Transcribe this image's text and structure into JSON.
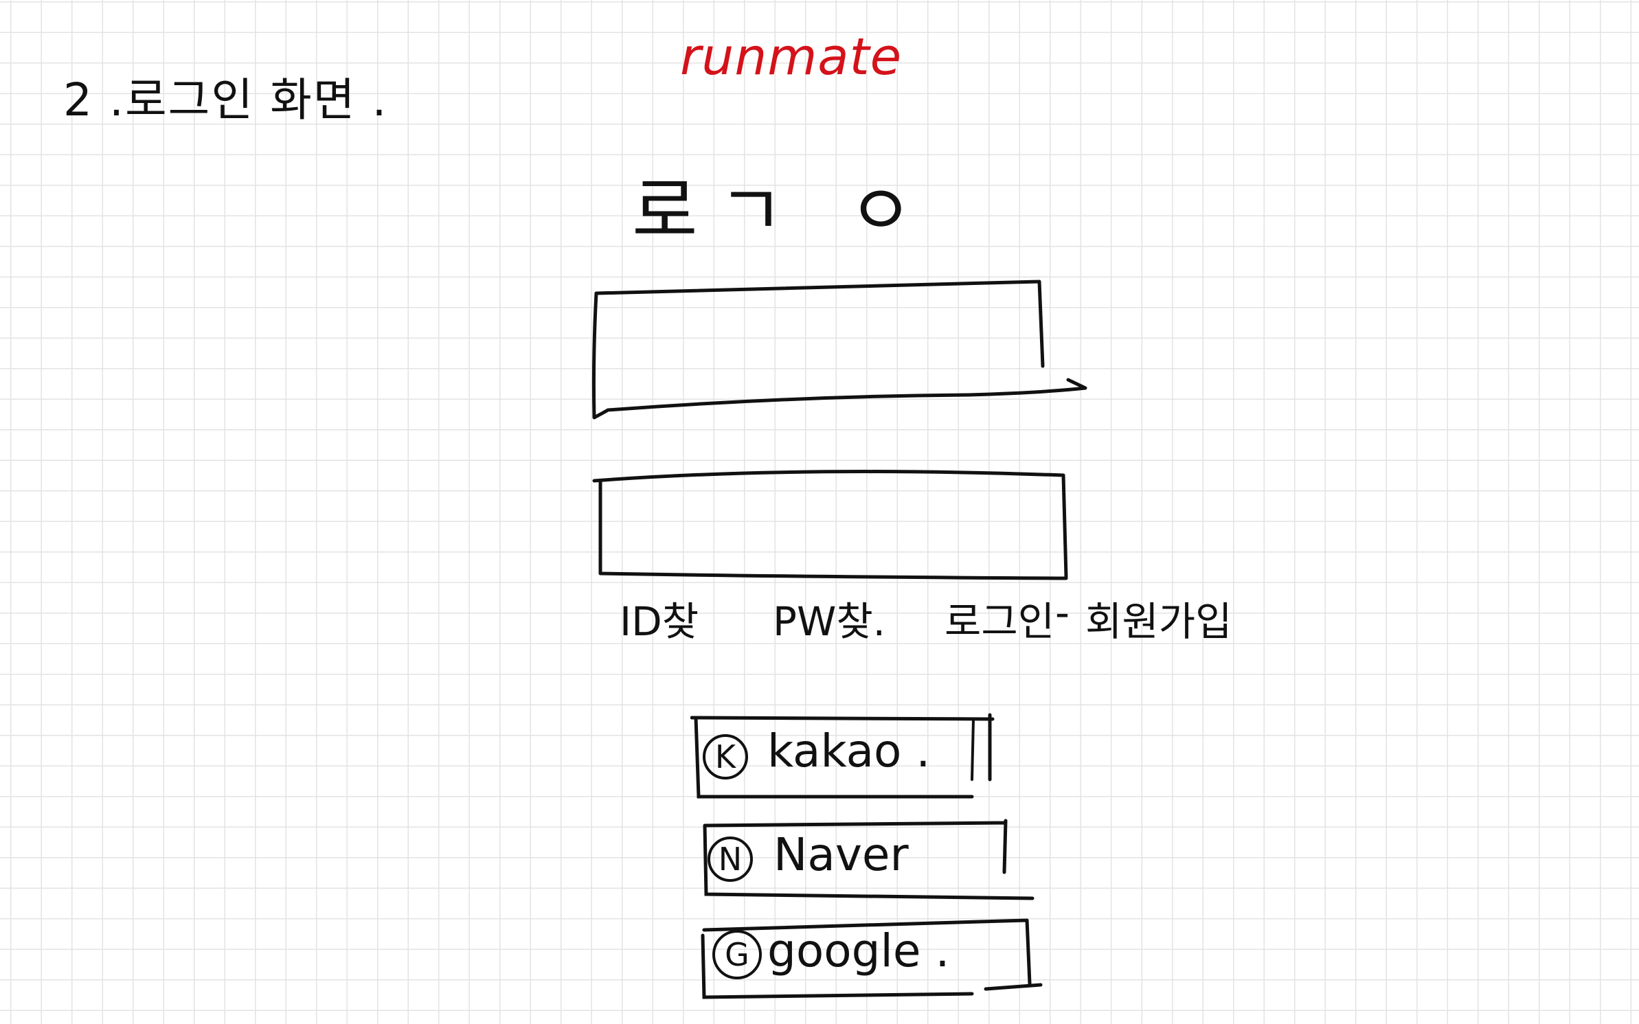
{
  "note": {
    "title": "2 .로그인 화면 ."
  },
  "app": {
    "name": "runmate",
    "name_color": "#d4121a"
  },
  "logo": {
    "text": "로ㄱ ㅇ"
  },
  "form": {
    "id_field": {
      "value": "",
      "placeholder": ""
    },
    "pw_field": {
      "value": "",
      "placeholder": ""
    }
  },
  "links": {
    "find_id": "ID찾",
    "find_pw": "PW찾.",
    "login": "로그인",
    "separator": "-",
    "signup": "회원가입"
  },
  "social": [
    {
      "badge": "K",
      "label": "kakao .",
      "icon": "kakao-icon"
    },
    {
      "badge": "N",
      "label": "Naver",
      "icon": "naver-icon"
    },
    {
      "badge": "G",
      "label": "google .",
      "icon": "google-icon"
    }
  ]
}
